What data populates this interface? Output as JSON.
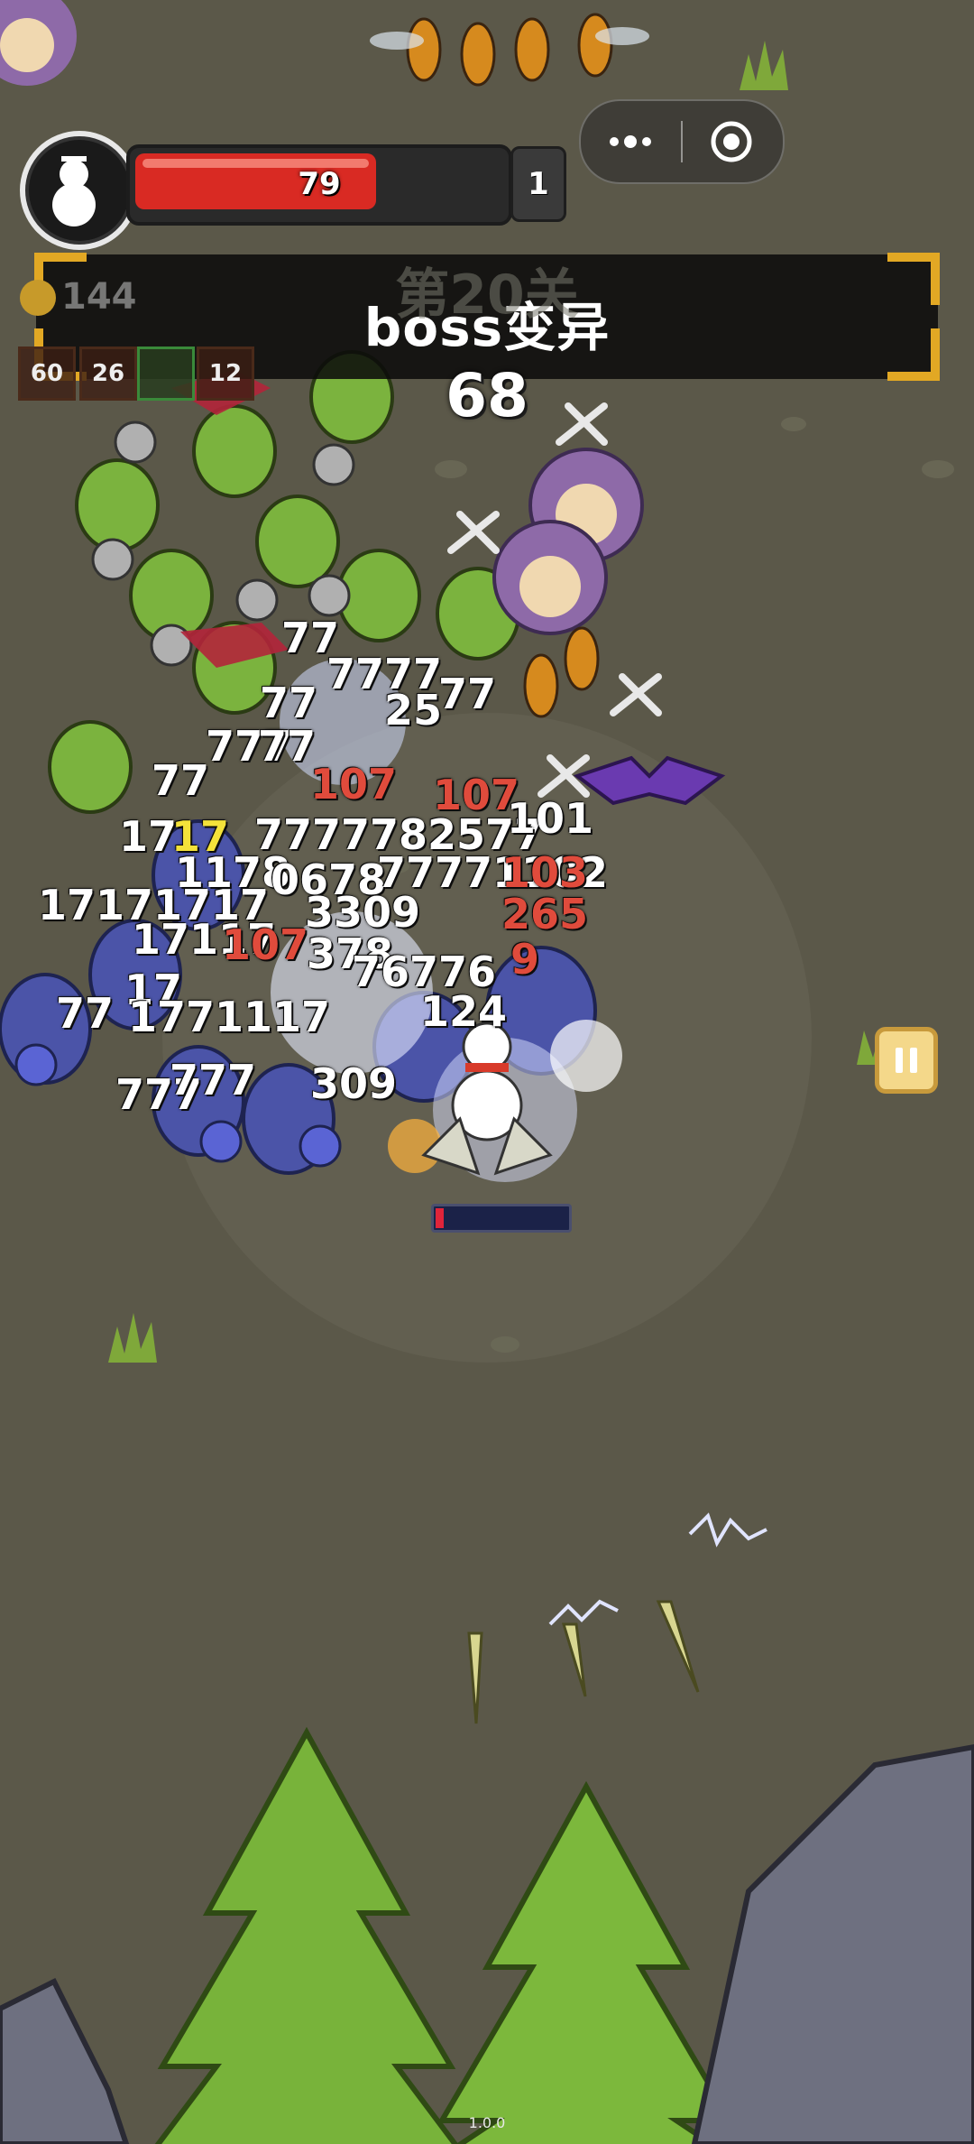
{
  "hud": {
    "player_icon": "snowman-icon",
    "hp_value": "79",
    "hp_fraction": 0.66,
    "level": "1",
    "menu_icon": "more-dots-icon",
    "target_icon": "record-target-icon",
    "banner_text": "boss变异",
    "stage_title": "第20关",
    "coin_count": "144",
    "kill_count": "68",
    "skill_slots": [
      "60",
      "26",
      "",
      "12"
    ],
    "pause_icon": "pause-icon",
    "player_hp_fraction": 0.06,
    "version": "1.0.0"
  },
  "damage_numbers": [
    {
      "text": "77",
      "color": "white"
    },
    {
      "text": "7777",
      "color": "white"
    },
    {
      "text": "77",
      "color": "white"
    },
    {
      "text": "25",
      "color": "white"
    },
    {
      "text": "77",
      "color": "white"
    },
    {
      "text": "777",
      "color": "white"
    },
    {
      "text": "77",
      "color": "white"
    },
    {
      "text": "77",
      "color": "white"
    },
    {
      "text": "107",
      "color": "red"
    },
    {
      "text": "107",
      "color": "red"
    },
    {
      "text": "7777",
      "color": "white"
    },
    {
      "text": "782577",
      "color": "white"
    },
    {
      "text": "101",
      "color": "white"
    },
    {
      "text": "17",
      "color": "white"
    },
    {
      "text": "17",
      "color": "yellow"
    },
    {
      "text": "1178",
      "color": "white"
    },
    {
      "text": "0678",
      "color": "white"
    },
    {
      "text": "77771102",
      "color": "white"
    },
    {
      "text": "103",
      "color": "red"
    },
    {
      "text": "17171717",
      "color": "white"
    },
    {
      "text": "3309",
      "color": "white"
    },
    {
      "text": "265",
      "color": "red"
    },
    {
      "text": "17117",
      "color": "white"
    },
    {
      "text": "107",
      "color": "red"
    },
    {
      "text": "378",
      "color": "white"
    },
    {
      "text": "76776",
      "color": "white"
    },
    {
      "text": "9",
      "color": "red"
    },
    {
      "text": "17",
      "color": "white"
    },
    {
      "text": "77",
      "color": "white"
    },
    {
      "text": "1771117",
      "color": "white"
    },
    {
      "text": "124",
      "color": "white"
    },
    {
      "text": "777",
      "color": "white"
    },
    {
      "text": "777",
      "color": "white"
    },
    {
      "text": "309",
      "color": "white"
    }
  ]
}
